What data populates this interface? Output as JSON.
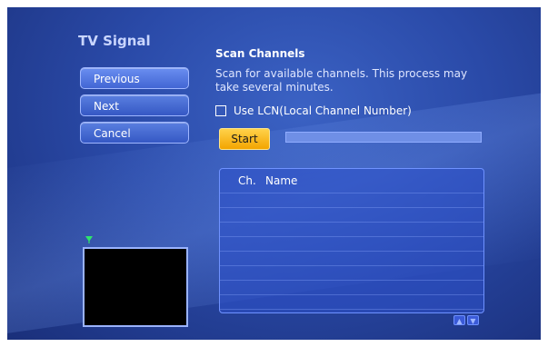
{
  "window": {
    "title": "TV Signal"
  },
  "nav": {
    "previous_label": "Previous",
    "next_label": "Next",
    "cancel_label": "Cancel"
  },
  "scan": {
    "title": "Scan Channels",
    "description": "Scan for available channels. This process may take several minutes.",
    "lcn_label": "Use LCN(Local Channel Number)",
    "lcn_checked": false,
    "start_label": "Start",
    "progress": 0
  },
  "channel_list": {
    "columns": [
      "Ch.",
      "Name"
    ],
    "rows": []
  },
  "colors": {
    "background": "#2a4aa8",
    "accent_button": "#f3a500",
    "nav_button": "#4266d4",
    "signal_icon": "#2ee66b"
  },
  "icons": {
    "signal": "antenna-signal-icon",
    "scroll_up": "chevron-up-icon",
    "scroll_down": "chevron-down-icon"
  }
}
